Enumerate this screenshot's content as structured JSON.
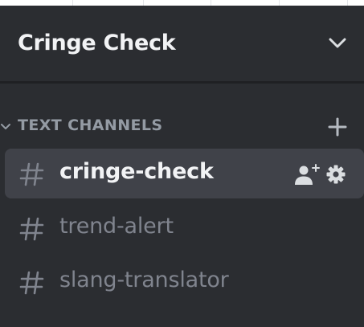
{
  "server": {
    "name": "Cringe Check"
  },
  "category": {
    "label": "TEXT CHANNELS"
  },
  "channels": [
    {
      "name": "cringe-check",
      "selected": true
    },
    {
      "name": "trend-alert",
      "selected": false
    },
    {
      "name": "slang-translator",
      "selected": false
    }
  ],
  "icons": {
    "header_menu": "chevron-down-icon",
    "category_toggle": "chevron-down-icon",
    "add_channel": "plus-icon",
    "channel_type": "hashtag-icon",
    "invite": "add-user-icon",
    "settings": "gear-icon"
  },
  "colors": {
    "background": "#2b2d31",
    "selected_channel_bg": "#404249",
    "primary_text": "#f2f3f5",
    "muted_text": "#80848e",
    "category_text": "#949ba4"
  }
}
